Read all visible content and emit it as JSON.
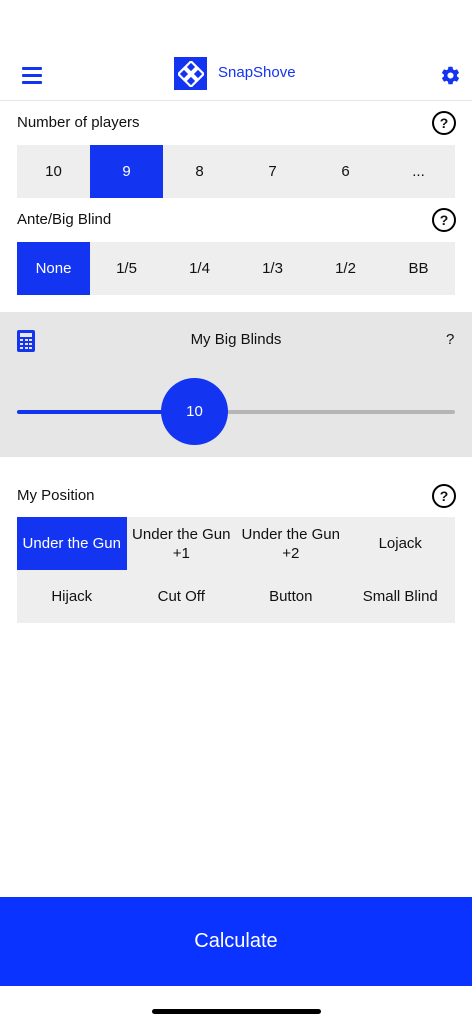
{
  "header": {
    "title": "SnapShove"
  },
  "players": {
    "label": "Number of players",
    "options": [
      "10",
      "9",
      "8",
      "7",
      "6",
      "..."
    ],
    "selected": "9"
  },
  "ante": {
    "label": "Ante/Big Blind",
    "options": [
      "None",
      "1/5",
      "1/4",
      "1/3",
      "1/2",
      "BB"
    ],
    "selected": "None"
  },
  "big_blinds": {
    "label": "My Big Blinds",
    "help": "?",
    "value": "10",
    "level_fraction": 0.4
  },
  "position": {
    "label": "My Position",
    "options": [
      "Under the Gun",
      "Under the Gun +1",
      "Under the Gun +2",
      "Lojack",
      "Hijack",
      "Cut Off",
      "Button",
      "Small Blind"
    ],
    "selected": "Under the Gun"
  },
  "help_icon": "?",
  "calculate_label": "Calculate",
  "colors": {
    "accent": "#1334f0",
    "button": "#0a33ff",
    "segment_bg": "#eeeeee",
    "panel_bg": "#e6e6e6"
  },
  "icons": [
    "menu-icon",
    "app-logo-icon",
    "gear-icon",
    "help-icon",
    "calculator-icon"
  ]
}
